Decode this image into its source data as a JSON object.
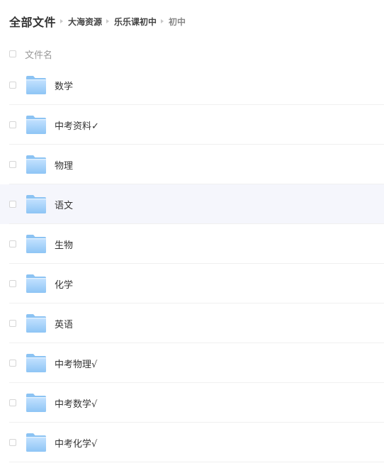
{
  "breadcrumb": {
    "root": "全部文件",
    "items": [
      "大海资源",
      "乐乐课初中",
      "初中"
    ]
  },
  "list_header": {
    "label": "文件名"
  },
  "files": [
    {
      "name": "数学"
    },
    {
      "name": "中考资料✓"
    },
    {
      "name": "物理"
    },
    {
      "name": "语文"
    },
    {
      "name": "生物"
    },
    {
      "name": "化学"
    },
    {
      "name": "英语"
    },
    {
      "name": "中考物理√"
    },
    {
      "name": "中考数学√"
    },
    {
      "name": "中考化学√"
    }
  ],
  "icons": {
    "folder": "folder-icon"
  },
  "colors": {
    "folder_light": "#b7dcff",
    "folder_dark": "#7fbcf2",
    "hover_row": "#f5f6fc"
  }
}
